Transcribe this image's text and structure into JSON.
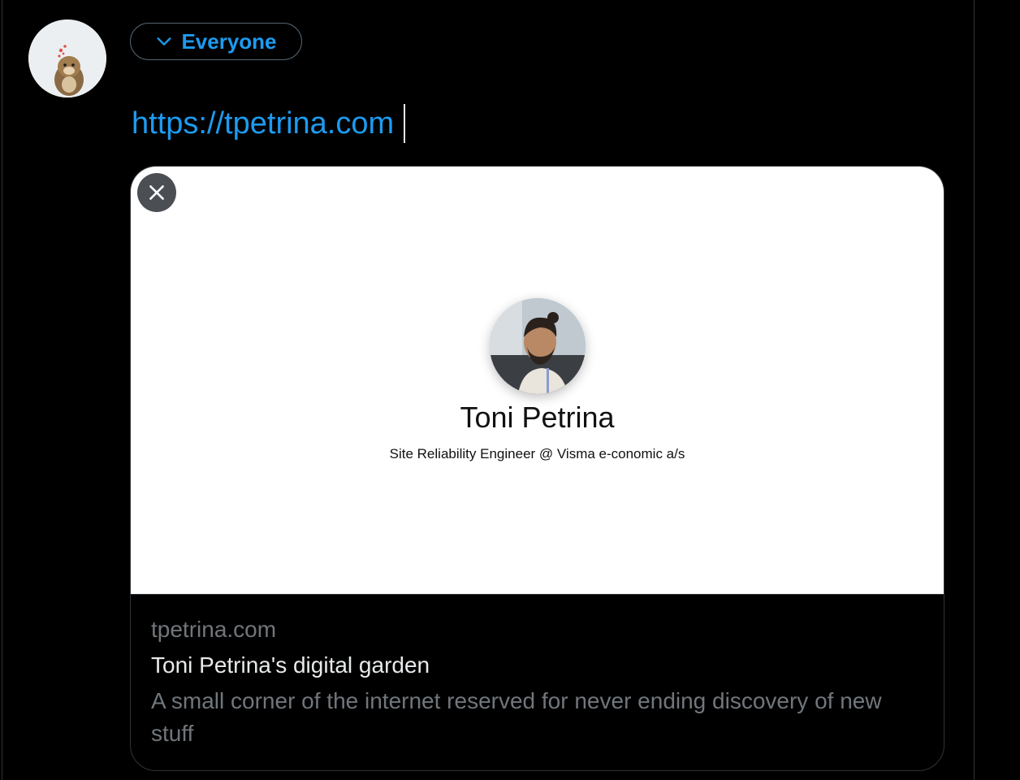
{
  "composer": {
    "audience_label": "Everyone",
    "text": "https://tpetrina.com"
  },
  "link_card": {
    "preview": {
      "name": "Toni Petrina",
      "role": "Site Reliability Engineer @ Visma e-conomic a/s"
    },
    "domain": "tpetrina.com",
    "title": "Toni Petrina's digital garden",
    "description": "A small corner of the internet reserved for never ending discovery of new stuff"
  },
  "colors": {
    "accent": "#1d9bf0",
    "background": "#000000",
    "border": "#2f3336",
    "muted_text": "#71767b",
    "primary_text": "#e7e9ea"
  },
  "icons": {
    "audience": "chevron-down-icon",
    "remove_card": "close-icon"
  }
}
